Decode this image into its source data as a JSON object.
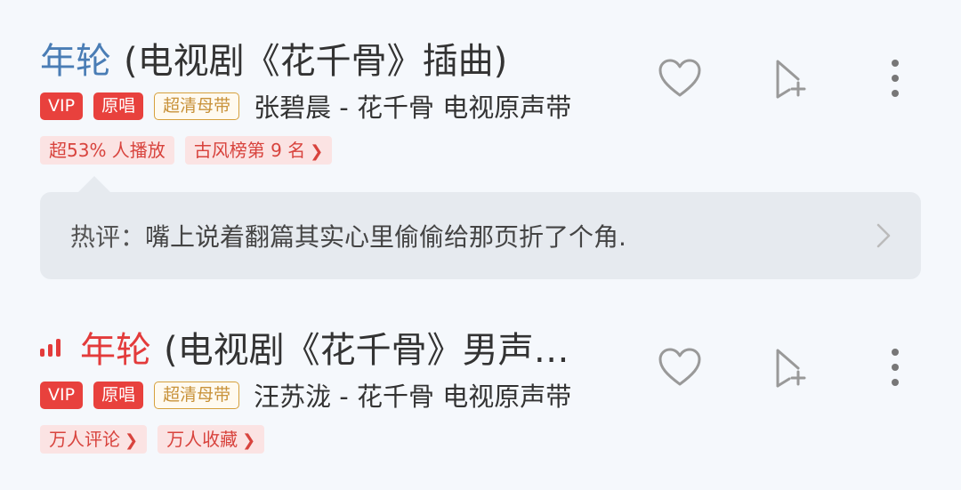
{
  "songs": [
    {
      "name": "年轮",
      "subtitle": "(电视剧《花千骨》插曲)",
      "badges": {
        "vip": "VIP",
        "original": "原唱",
        "hq": "超清母带"
      },
      "artist": "张碧晨 - 花千骨 电视原声带",
      "tags": [
        "超53% 人播放",
        "古风榜第 9 名"
      ],
      "comment": {
        "label": "热评：",
        "text": "嘴上说着翻篇其实心里偷偷给那页折了个角."
      }
    },
    {
      "name": "年轮",
      "subtitle": "(电视剧《花千骨》男声…",
      "badges": {
        "vip": "VIP",
        "original": "原唱",
        "hq": "超清母带"
      },
      "artist": "汪苏泷 - 花千骨 电视原声带",
      "tags": [
        "万人评论",
        "万人收藏"
      ]
    }
  ],
  "icons": {
    "like": "heart-outline-icon",
    "add": "add-to-playlist-icon",
    "more": "more-vertical-icon",
    "playing": "now-playing-bars-icon",
    "chevron": "chevron-right-icon"
  },
  "colors": {
    "accent_red": "#e33b3b",
    "song_name_blue": "#4a7db5",
    "hq_gold": "#c8923a",
    "tag_bg": "#fbe3e3",
    "comment_bg": "#e6eaef"
  }
}
